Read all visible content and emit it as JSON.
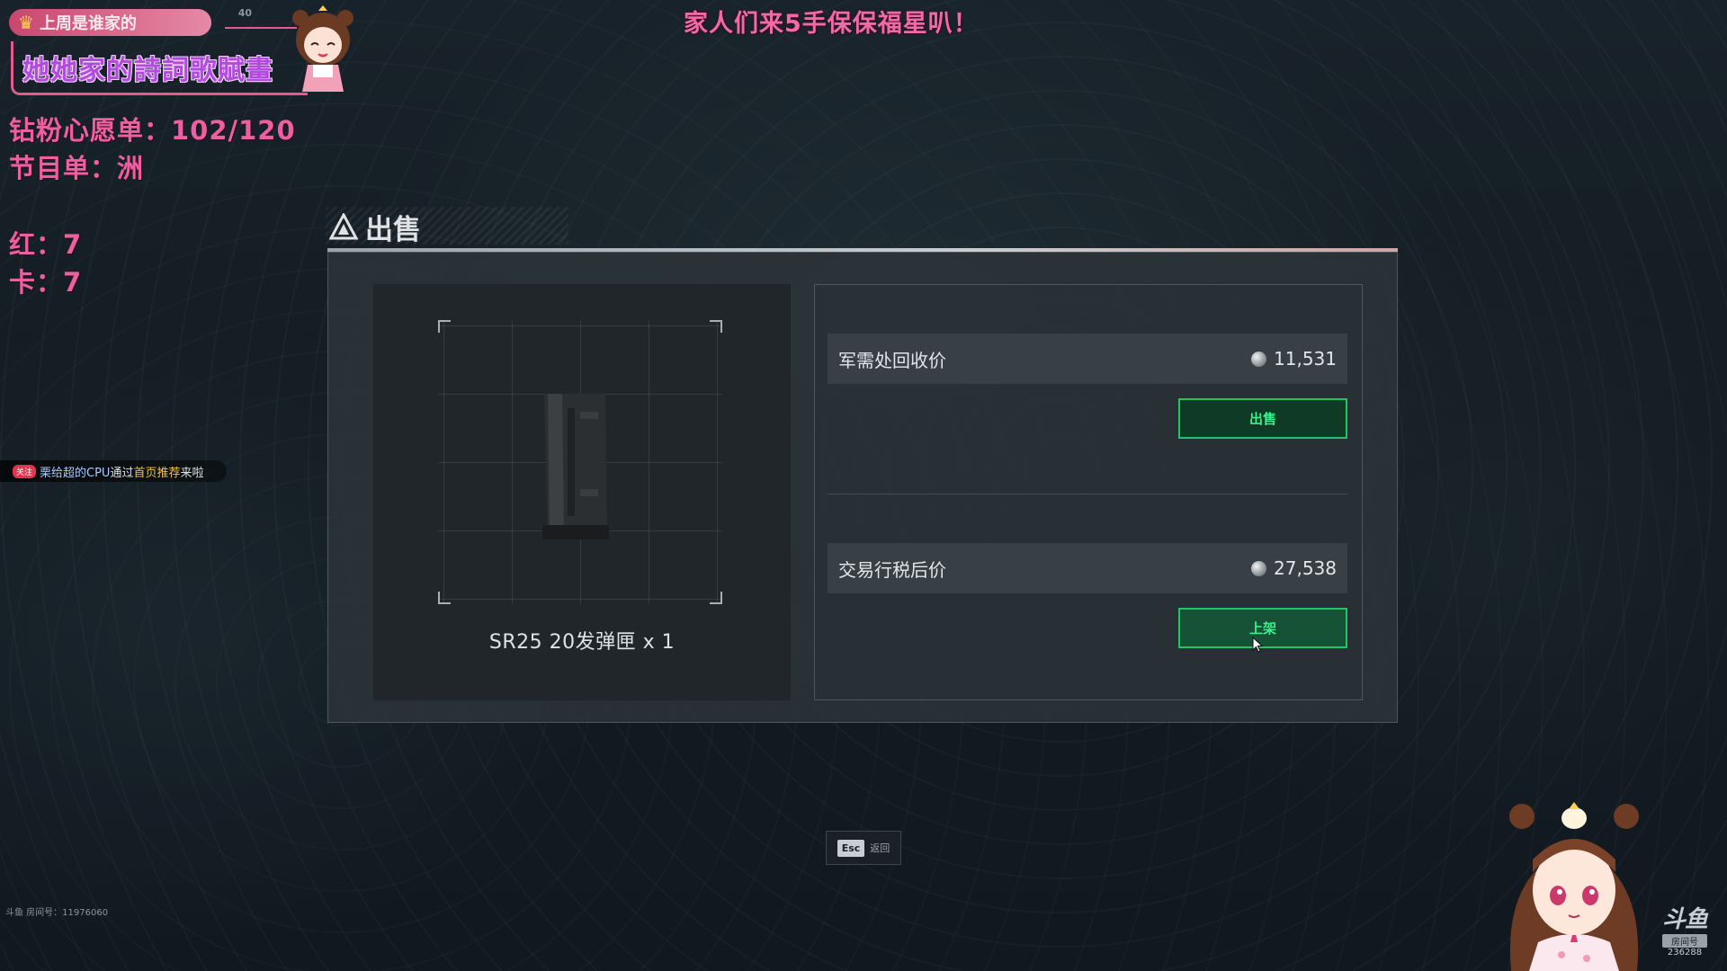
{
  "overlay": {
    "banner": "家人们来5手保保福星叭！",
    "top_badge": "上周是谁家的",
    "badge_ref": "40",
    "name_plate": "她她家的詩詞歌賦畫",
    "wish_list": "钻粉心愿单：102/120",
    "program": "节目单：洲",
    "red_count": "红：7",
    "card_count": "卡：7",
    "follow_toast": {
      "tag": "关注",
      "user": "栗给超的CPU",
      "via": "通过",
      "source": "首页推荐",
      "suffix": "来啦"
    },
    "room_id": "斗鱼 房间号：11976060",
    "platform": {
      "logo": "斗鱼",
      "tag": "房间号",
      "number": "236288"
    }
  },
  "dialog": {
    "title": "出售",
    "item": {
      "name": "SR25 20发弹匣 x 1"
    },
    "recycle": {
      "label": "军需处回收价",
      "value": "11,531",
      "button": "出售"
    },
    "market": {
      "label": "交易行税后价",
      "value": "27,538",
      "button": "上架"
    },
    "esc": {
      "key": "Esc",
      "label": "返回"
    }
  },
  "colors": {
    "accent_green": "#23c466",
    "overlay_pink": "#ee5fa1",
    "name_purple": "#b14bdc"
  },
  "icons": {
    "title_icon": "triangle-warning-icon",
    "coin": "coin-icon",
    "crown": "crown-icon"
  }
}
